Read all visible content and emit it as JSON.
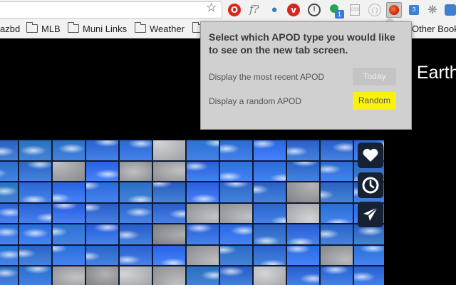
{
  "toolbar": {
    "bookmark_star": "☆",
    "extensions": [
      {
        "name": "opera-icon",
        "glyph": "O"
      },
      {
        "name": "font-icon",
        "glyph": "f?"
      },
      {
        "name": "drop-icon",
        "glyph": "💧"
      },
      {
        "name": "vivaldi-icon",
        "glyph": "V"
      },
      {
        "name": "info-icon",
        "glyph": "i"
      },
      {
        "name": "green-dot-icon",
        "badge": "1"
      },
      {
        "name": "css-icon",
        "glyph": "CSS"
      },
      {
        "name": "grey-circle-icon",
        "glyph": "( )"
      },
      {
        "name": "apod-extension-icon",
        "glyph": ""
      },
      {
        "name": "blue-box-icon",
        "glyph": "3"
      },
      {
        "name": "react-icon",
        "glyph": "⚛"
      },
      {
        "name": "bookmark-ribbon-icon",
        "glyph": ""
      }
    ]
  },
  "bookmarks": {
    "partial_left": "azbd",
    "items": [
      "MLB",
      "Muni Links",
      "Weather"
    ],
    "partial_right": "Other Book"
  },
  "page": {
    "title_partial": "n Earth"
  },
  "sidebar_buttons": [
    {
      "name": "favorite-button",
      "icon": "heart-icon"
    },
    {
      "name": "history-button",
      "icon": "clock-icon"
    },
    {
      "name": "share-button",
      "icon": "paper-plane-icon"
    }
  ],
  "popup": {
    "title": "Select which APOD type you would like to see on the new tab screen.",
    "option_recent_label": "Display the most recent APOD",
    "today_button": "Today",
    "option_random_label": "Display a random APOD",
    "random_button": "Random"
  },
  "colors": {
    "random_button_bg": "#f8f20e",
    "today_button_bg": "#c4c4c4",
    "popup_bg": "#d0d0d0"
  }
}
